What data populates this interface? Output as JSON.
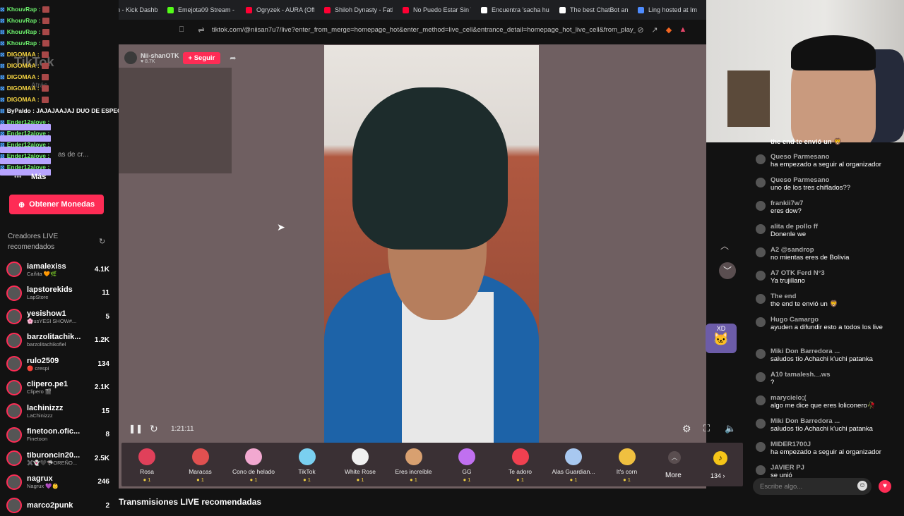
{
  "browser": {
    "tabs": [
      {
        "label": "Stream - Kick Dashbo",
        "color": "#53fc18"
      },
      {
        "label": "Emejota09 Stream - W",
        "color": "#53fc18"
      },
      {
        "label": "Ogryzek - AURA (Offic",
        "color": "#ff0033"
      },
      {
        "label": "Shiloh Dynasty - Fathe",
        "color": "#ff0033"
      },
      {
        "label": "No Puedo Estar Sin Ti",
        "color": "#ff0033"
      },
      {
        "label": "Encuentra 'sacha huan",
        "color": "#ffffff"
      },
      {
        "label": "The best ChatBot and",
        "color": "#ffffff"
      },
      {
        "label": "Ling hosted at Im",
        "color": "#4e8cff"
      }
    ],
    "url": "tiktok.com/@niisan7u7/live?enter_from_merge=homepage_hot&enter_method=live_cell&entrance_detail=homepage_hot_live_cell&from_play_..."
  },
  "overlay_chat": [
    {
      "name": "KhouvRap :",
      "color": "green"
    },
    {
      "name": "KhouvRap :",
      "color": "green"
    },
    {
      "name": "KhouvRap :",
      "color": "green"
    },
    {
      "name": "KhouvRap :",
      "color": "green"
    },
    {
      "name": "DIGOMAA :",
      "color": "yellow"
    },
    {
      "name": "DIGOMAA :",
      "color": "yellow"
    },
    {
      "name": "DIGOMAA :",
      "color": "yellow"
    },
    {
      "name": "DIGOMAA :",
      "color": "yellow"
    },
    {
      "name": "DIGOMAA :",
      "color": "yellow"
    },
    {
      "name": "ByPaldo : JAJAJAAJAJ DUO DE ESPECIALES",
      "color": "blue"
    },
    {
      "name": "Ender12alove :",
      "color": "green"
    },
    {
      "name": "Ender12alove :",
      "color": "green"
    },
    {
      "name": "Ender12alove :",
      "color": "green"
    },
    {
      "name": "Ender12alove :",
      "color": "green"
    },
    {
      "name": "Ender12alove :",
      "color": "green"
    }
  ],
  "sidebar": {
    "logo": "TikTok",
    "back_label": "Atrás",
    "ghost_label": "as de cr...",
    "more_label": "Más",
    "coins_label": "Obtener Monedas",
    "recommended_title": "Creadores LIVE recomendados",
    "creators": [
      {
        "name": "iamalexiss",
        "sub": "Cañita 🧡🌿",
        "count": "4.1K"
      },
      {
        "name": "lapstorekids",
        "sub": "LapStore",
        "count": "11"
      },
      {
        "name": "yesishow1",
        "sub": "🌸usYESI SHOW#...",
        "count": "5"
      },
      {
        "name": "barzolitachik...",
        "sub": "barzolitachikofiel",
        "count": "1.2K"
      },
      {
        "name": "rulo2509",
        "sub": "🔴 crespi",
        "count": "134"
      },
      {
        "name": "clipero.pe1",
        "sub": "Clipero 🎬",
        "count": "2.1K"
      },
      {
        "name": "lachinizzz",
        "sub": "LaChinizzz",
        "count": "15"
      },
      {
        "name": "finetoon.ofic...",
        "sub": "Finetoon",
        "count": "8"
      },
      {
        "name": "tiburoncin20...",
        "sub": "✖️👻🖤🦈OREÑO...",
        "count": "2.5K"
      },
      {
        "name": "nagrux",
        "sub": "Nagrux 💜👶",
        "count": "246"
      },
      {
        "name": "marco2punk",
        "sub": "",
        "count": "2"
      }
    ]
  },
  "stream": {
    "host_name": "Nii-shanOTK",
    "host_likes": "8.7K",
    "follow_label": "+ Seguir",
    "elapsed": "1:21:11",
    "gifts": [
      {
        "name": "Rosa",
        "price": "1",
        "color": "#e0405a"
      },
      {
        "name": "Maracas",
        "price": "1",
        "color": "#e05050"
      },
      {
        "name": "Cono de helado",
        "price": "1",
        "color": "#f2a8d0"
      },
      {
        "name": "TikTok",
        "price": "1",
        "color": "#7ad0f0"
      },
      {
        "name": "White Rose",
        "price": "1",
        "color": "#f0f0f0"
      },
      {
        "name": "Eres increíble",
        "price": "1",
        "color": "#d8a070"
      },
      {
        "name": "GG",
        "price": "1",
        "color": "#c070f0"
      },
      {
        "name": "Te adoro",
        "price": "1",
        "color": "#f04050"
      },
      {
        "name": "Alas Guardian...",
        "price": "1",
        "color": "#a8c8f0"
      },
      {
        "name": "It's corn",
        "price": "1",
        "color": "#f0c040"
      }
    ],
    "more_label": "More",
    "coin_balance": "134 ›",
    "recommended_live": "Transmisiones LIVE recomendadas"
  },
  "chat": {
    "messages": [
      {
        "name": "the end te envió un 🦁",
        "text": ""
      },
      {
        "name": "Queso Parmesano",
        "text": "ha empezado a seguir al organizador"
      },
      {
        "name": "Queso Parmesano",
        "text": "uno de los tres chiflados??"
      },
      {
        "name": "frankii7w7",
        "text": "eres dow?"
      },
      {
        "name": "alita de pollo ff",
        "text": "Donenle we"
      },
      {
        "name": "A2 @sandrop",
        "text": "no mientas eres de Bolivia"
      },
      {
        "name": "A7 OTK Ferd N°3",
        "text": "Ya trujillano"
      },
      {
        "name": "The end",
        "text": "the end te envió un 🦁"
      },
      {
        "name": "Hugo Camargo",
        "text": "ayuden a difundir esto a todos los live"
      },
      {
        "name": "Miki Don Barredora ...",
        "text": "saludos tío Achachi k'uchi patanka"
      },
      {
        "name": "A10 tamalesh._.ws",
        "text": "?"
      },
      {
        "name": "marycielo;(",
        "text": "algo me dice que eres loliconero🥀"
      },
      {
        "name": "Miki Don Barredora ...",
        "text": "saludos tío Achachi k'uchi patanka"
      },
      {
        "name": "MIDER1700J",
        "text": "ha empezado a seguir al organizador"
      },
      {
        "name": "JAVIER PJ",
        "text": "se unió"
      }
    ],
    "input_placeholder": "Escribe algo...",
    "sticker_label": "XD"
  }
}
